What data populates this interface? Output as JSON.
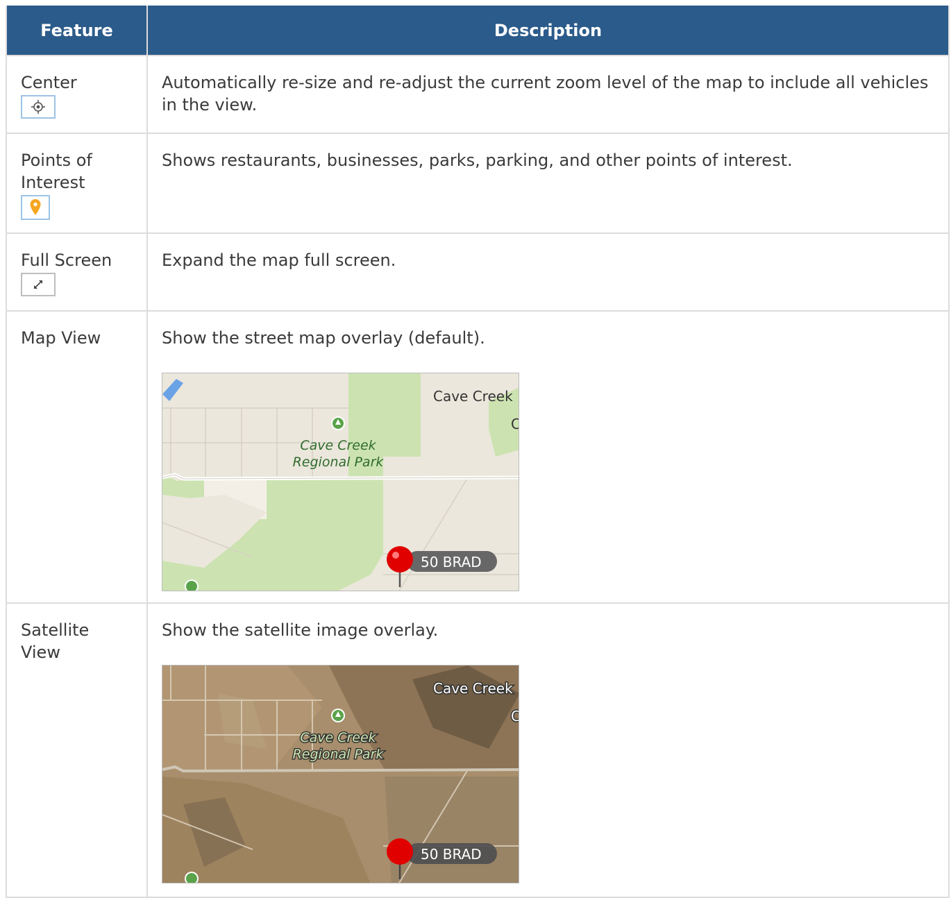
{
  "table": {
    "headers": {
      "feature": "Feature",
      "description": "Description"
    },
    "rows": [
      {
        "feature": "Center",
        "icon": "center-crosshair-icon",
        "description": "Automatically re-size and re-adjust the current zoom level of the map to include all vehicles in the view."
      },
      {
        "feature": "Points of Interest",
        "icon": "poi-pin-icon",
        "description": "Shows restaurants, businesses, parks, parking, and other points of interest."
      },
      {
        "feature": "Full Screen",
        "icon": "expand-arrows-icon",
        "description": "Expand the map full screen."
      },
      {
        "feature": "Map View",
        "description": "Show the street map overlay (default).",
        "map": {
          "town_label": "Cave Creek",
          "park_label_line1": "Cave Creek",
          "park_label_line2": "Regional Park",
          "partial_label": "C",
          "vehicle_label": "50 BRAD"
        }
      },
      {
        "feature": "Satellite View",
        "description": "Show the satellite image overlay.",
        "map": {
          "town_label": "Cave Creek",
          "park_label_line1": "Cave Creek",
          "park_label_line2": "Regional Park",
          "partial_label": "C",
          "vehicle_label": "50 BRAD"
        }
      }
    ]
  },
  "colors": {
    "header_bg": "#2b5b8a",
    "header_text": "#ffffff",
    "grid": "#dcdcdc",
    "icon_border": "#9dc3e6",
    "poi_pin": "#f5a623",
    "vehicle_marker": "#e00000"
  }
}
